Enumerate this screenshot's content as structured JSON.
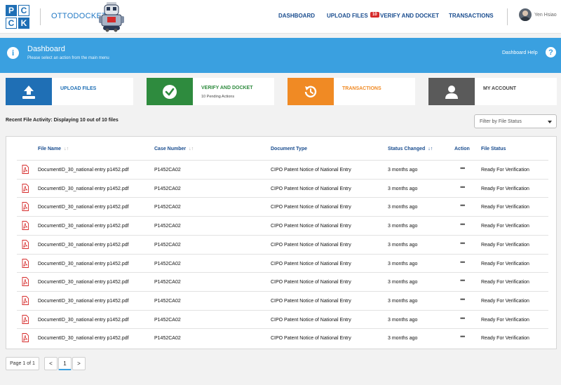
{
  "header": {
    "logo_letters": [
      "P",
      "C",
      "C",
      "K"
    ],
    "brand_name": "OTTODOCKET",
    "nav": {
      "dashboard": "DASHBOARD",
      "upload_files": "UPLOAD FILES",
      "verify_badge": "10",
      "verify_and_docket": "VERIFY AND DOCKET",
      "transactions": "TRANSACTIONS"
    },
    "user_name": "Yen Hsiao"
  },
  "banner": {
    "info_glyph": "i",
    "title": "Dashboard",
    "subtitle": "Please select an action from the main menu",
    "help_label": "Dashboard Help",
    "help_glyph": "?"
  },
  "cards": {
    "upload": {
      "label": "UPLOAD FILES",
      "color": "#1f6fb5"
    },
    "verify": {
      "label": "VERIFY AND DOCKET",
      "sub": "10 Pending Actions",
      "color": "#2e8b3e"
    },
    "transactions": {
      "label": "TRANSACTIONS",
      "color": "#f08a24"
    },
    "account": {
      "label": "MY ACCOUNT",
      "color": "#5a5a5a"
    }
  },
  "activity": {
    "title": "Recent File Activity: Displaying 10 out of 10 files",
    "filter_placeholder": "Filter by File Status"
  },
  "table": {
    "headers": {
      "file_name": "File Name",
      "case_number": "Case Number",
      "document_type": "Document Type",
      "status_changed": "Status Changed",
      "action": "Action",
      "file_status": "File Status"
    },
    "action_glyph": "•••",
    "rows": [
      {
        "file_name": "DocumentID_30_national entry p1452.pdf",
        "case_number": "P1452CA02",
        "document_type": "CIPO Patent Notice of National Entry",
        "status_changed": "3 months ago",
        "file_status": "Ready For Verification"
      },
      {
        "file_name": "DocumentID_30_national entry p1452.pdf",
        "case_number": "P1452CA02",
        "document_type": "CIPO Patent Notice of National Entry",
        "status_changed": "3 months ago",
        "file_status": "Ready For Verification"
      },
      {
        "file_name": "DocumentID_30_national entry p1452.pdf",
        "case_number": "P1452CA02",
        "document_type": "CIPO Patent Notice of National Entry",
        "status_changed": "3 months ago",
        "file_status": "Ready For Verification"
      },
      {
        "file_name": "DocumentID_30_national entry p1452.pdf",
        "case_number": "P1452CA02",
        "document_type": "CIPO Patent Notice of National Entry",
        "status_changed": "3 months ago",
        "file_status": "Ready For Verification"
      },
      {
        "file_name": "DocumentID_30_national entry p1452.pdf",
        "case_number": "P1452CA02",
        "document_type": "CIPO Patent Notice of National Entry",
        "status_changed": "3 months ago",
        "file_status": "Ready For Verification"
      },
      {
        "file_name": "DocumentID_30_national entry p1452.pdf",
        "case_number": "P1452CA02",
        "document_type": "CIPO Patent Notice of National Entry",
        "status_changed": "3 months ago",
        "file_status": "Ready For Verification"
      },
      {
        "file_name": "DocumentID_30_national entry p1452.pdf",
        "case_number": "P1452CA02",
        "document_type": "CIPO Patent Notice of National Entry",
        "status_changed": "3 months ago",
        "file_status": "Ready For Verification"
      },
      {
        "file_name": "DocumentID_30_national entry p1452.pdf",
        "case_number": "P1452CA02",
        "document_type": "CIPO Patent Notice of National Entry",
        "status_changed": "3 months ago",
        "file_status": "Ready For Verification"
      },
      {
        "file_name": "DocumentID_30_national entry p1452.pdf",
        "case_number": "P1452CA02",
        "document_type": "CIPO Patent Notice of National Entry",
        "status_changed": "3 months ago",
        "file_status": "Ready For Verification"
      },
      {
        "file_name": "DocumentID_30_national entry p1452.pdf",
        "case_number": "P1452CA02",
        "document_type": "CIPO Patent Notice of National Entry",
        "status_changed": "3 months ago",
        "file_status": "Ready For Verification"
      }
    ]
  },
  "pagination": {
    "info": "Page 1 of 1",
    "prev": "<",
    "current": "1",
    "next": ">"
  }
}
